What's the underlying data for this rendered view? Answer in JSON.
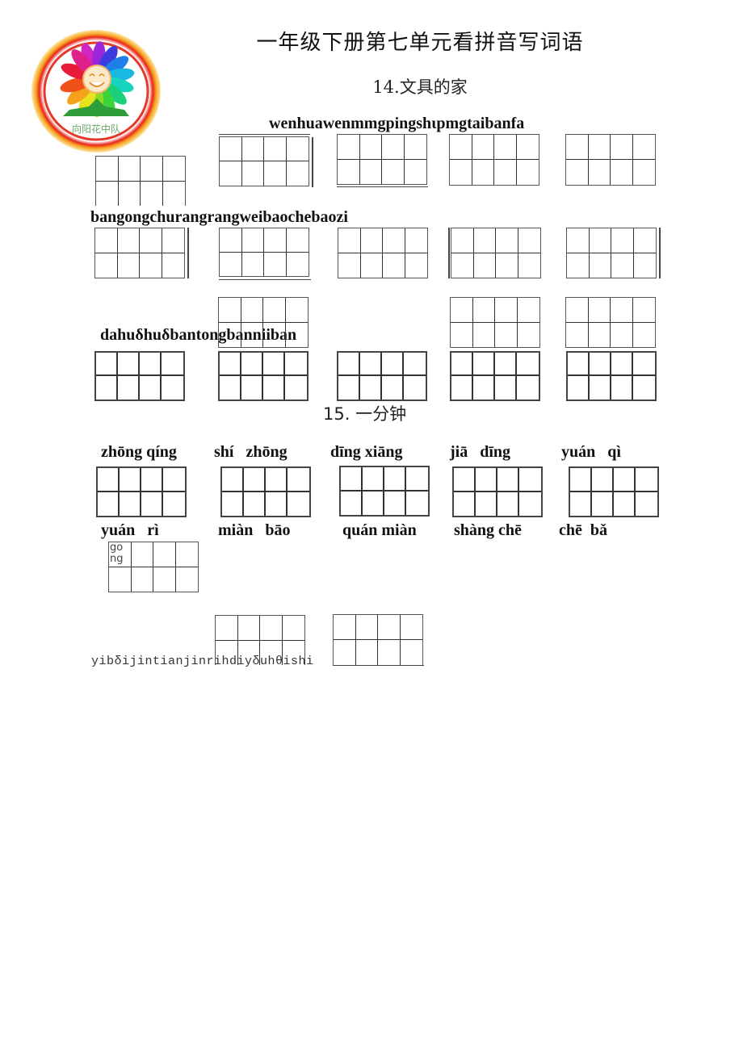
{
  "logo": {
    "icon": "sunflower-badge-icon",
    "text": "向阳花中队",
    "colors": {
      "ring": "#f5a623",
      "ring_inner": "#e02020",
      "stem": "#2e9e3a"
    }
  },
  "title": "一年级下册第七单元看拼音写词语",
  "lessons": [
    {
      "heading": "14.文具的家",
      "pinyin_lines": [
        "wenhuawenmmgpingshιpmgtaibanfa",
        "bangongchurangrangweibaochebaozi",
        "dahuδhuδbantongbanniiban"
      ]
    },
    {
      "heading": "15. 一分钟",
      "pinyin_row1": [
        "zhōng qíng",
        "shí   zhōng",
        "dīng xiāng",
        "jiā   dīng",
        "yuán   qì"
      ],
      "pinyin_row2": [
        "yuán   rì",
        "miàn   bāo",
        "quán miàn",
        "shàng chē",
        "chē  bǎ"
      ],
      "stray_cell_text": "go ng",
      "pinyin_line_mono": "yibδijintianjinrihdiyδuhθishi"
    }
  ]
}
